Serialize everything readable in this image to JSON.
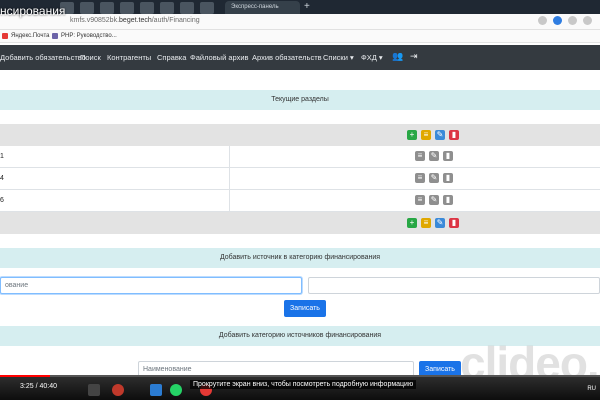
{
  "browser": {
    "page_title_overlay": "нсирования",
    "active_tab_label": "Экспресс-панель",
    "new_tab": "+",
    "url_prefix": "kmfs.v90852bk.",
    "url_domain": "beget.tech",
    "url_path": "/auth/Financing",
    "bookmarks": [
      {
        "label": "Яндекс.Почта"
      },
      {
        "label": "PHP: Руководство..."
      }
    ]
  },
  "nav": {
    "items": [
      "Добавить обязательство",
      "Поиск",
      "Контрагенты",
      "Справка",
      "Файловый архив",
      "Архив обязательств",
      "Списки ▾",
      "ФХД ▾"
    ],
    "icons": [
      "users-icon",
      "logout-icon"
    ]
  },
  "sections": {
    "current_sections": "Текущие разделы",
    "add_source": "Добавить источник в категорию финансирования",
    "add_category": "Добавить категорию источников финансирования"
  },
  "rows": [
    {
      "num": "1"
    },
    {
      "num": "4"
    },
    {
      "num": "6"
    }
  ],
  "form_source": {
    "name_placeholder": "ование",
    "submit": "Записать"
  },
  "form_category": {
    "name_placeholder": "Наименование",
    "submit": "Записать"
  },
  "watermark": "clideo.co",
  "player": {
    "time": "3:25 / 40:40",
    "progress": 0.084,
    "caption": "Прокрутите экран вниз, чтобы посмотреть подробную информацию",
    "tray": "RU"
  },
  "colors": {
    "nav_bg": "#343a40",
    "band_bg": "#d6eef0",
    "primary": "#1a73e8",
    "green": "#28a745",
    "yellow": "#e0a800",
    "blue": "#3b8ad9",
    "red": "#dc3545"
  }
}
